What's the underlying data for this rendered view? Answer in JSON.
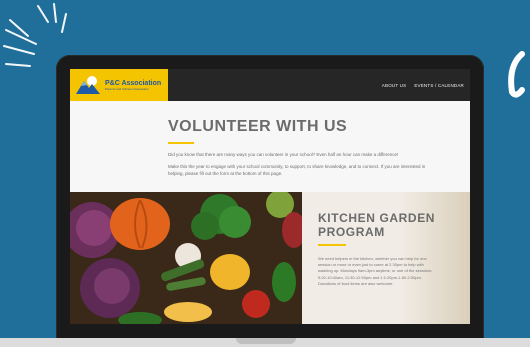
{
  "site": {
    "logo": {
      "title": "P&C Association",
      "subtitle": "Parents and Citizens Association"
    },
    "nav": {
      "items": [
        "ABOUT US",
        "EVENTS / CALENDAR"
      ]
    },
    "hero": {
      "title": "VOLUNTEER WITH US",
      "p1": "Did you know that there are many ways you can volunteer in your school? Even half an hour can make a difference!",
      "p2": "Make this the year to engage with your school community, to support, to share knowledge, and to connect. If you are interested in helping, please fill out the form at the bottom of this page."
    },
    "kitchen": {
      "title": "KITCHEN GARDEN PROGRAM",
      "text": "We need helpers in the kitchen, whether you can help for one session or more or even just to come at 2.30pm to help with washing up. Mondays 9am-3pm anytime, or one of the sessions: 9:20-10:40am, 11:30-12:50pm and 1:1:20pm-1:50-2:50pm. Donations of food items are also welcome."
    }
  },
  "colors": {
    "background": "#1f6f9a",
    "accent": "#f5c400",
    "header": "#262626",
    "brand_blue": "#1e5aa8"
  },
  "icons": {
    "logo_mark": "mountain-sun-logo"
  }
}
